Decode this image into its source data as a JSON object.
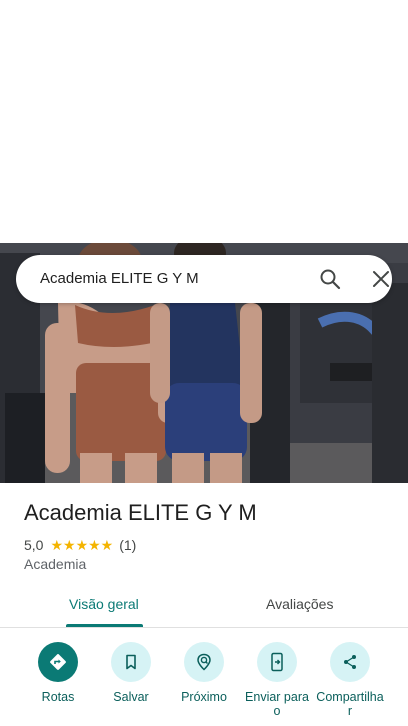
{
  "search": {
    "query": "Academia ELITE G Y M"
  },
  "place": {
    "title": "Academia ELITE G Y M",
    "rating": "5,0",
    "stars": "★★★★★",
    "review_count": "(1)",
    "category": "Academia"
  },
  "tabs": [
    {
      "label": "Visão geral",
      "selected": true
    },
    {
      "label": "Avaliações",
      "selected": false
    }
  ],
  "actions": [
    {
      "label": "Rotas",
      "icon": "directions-icon"
    },
    {
      "label": "Salvar",
      "icon": "bookmark-icon"
    },
    {
      "label": "Próximo",
      "icon": "nearby-icon"
    },
    {
      "label": "Enviar para o",
      "icon": "send-to-phone-icon"
    },
    {
      "label": "Compartilhar",
      "icon": "share-icon"
    }
  ],
  "colors": {
    "accent": "#0b7a75",
    "action_bg": "#d6f3f5",
    "star": "#f4b400"
  }
}
